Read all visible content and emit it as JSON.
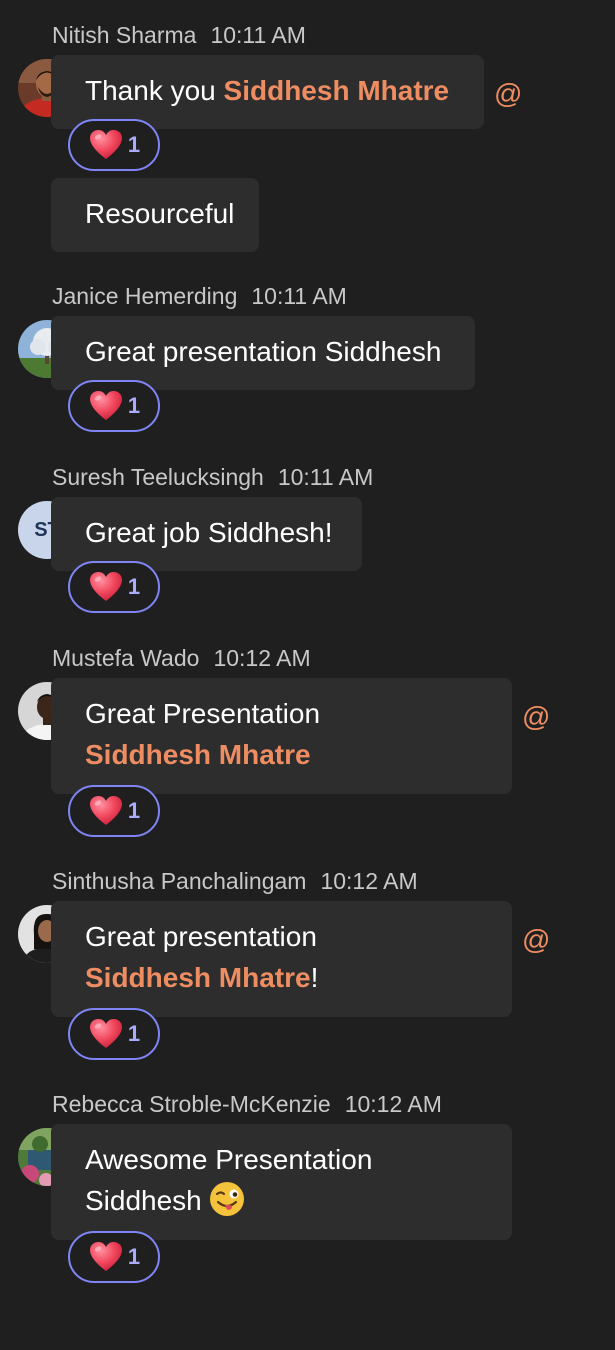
{
  "accent_colors": {
    "mention": "#ee8d62",
    "reaction_border": "#7f85f5",
    "bubble_bg": "#2d2d2d",
    "background": "#1f1f1f"
  },
  "messages": [
    {
      "author": "Nitish Sharma",
      "time": "10:11 AM",
      "avatar": "photo-avatar",
      "text_before": "Thank you ",
      "mention": "Siddhesh Mhatre",
      "at_icon": "@",
      "reaction": {
        "icon": "heart-icon",
        "count": "1"
      },
      "followup_text": "Resourceful"
    },
    {
      "author": "Janice Hemerding",
      "time": "10:11 AM",
      "avatar": "photo-avatar",
      "text": "Great presentation Siddhesh",
      "reaction": {
        "icon": "heart-icon",
        "count": "1"
      }
    },
    {
      "author": "Suresh Teelucksingh",
      "time": "10:11 AM",
      "avatar_initials": "ST",
      "text": "Great job Siddhesh!",
      "reaction": {
        "icon": "heart-icon",
        "count": "1"
      }
    },
    {
      "author": "Mustefa Wado",
      "time": "10:12 AM",
      "avatar": "photo-avatar",
      "text_line1": "Great Presentation",
      "mention": "Siddhesh Mhatre",
      "at_icon": "@",
      "reaction": {
        "icon": "heart-icon",
        "count": "1"
      }
    },
    {
      "author": "Sinthusha Panchalingam",
      "time": "10:12 AM",
      "avatar": "photo-avatar",
      "text_line1": "Great presentation",
      "mention": "Siddhesh Mhatre",
      "text_after": "!",
      "at_icon": "@",
      "reaction": {
        "icon": "heart-icon",
        "count": "1"
      }
    },
    {
      "author": "Rebecca Stroble-McKenzie",
      "time": "10:12 AM",
      "avatar": "photo-avatar",
      "text_line1": "Awesome Presentation",
      "text_line2": "Siddhesh",
      "emoji": "winking-face-with-tongue-icon",
      "reaction": {
        "icon": "heart-icon",
        "count": "1"
      }
    }
  ]
}
